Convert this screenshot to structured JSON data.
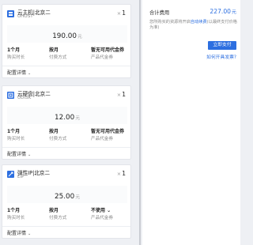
{
  "items": [
    {
      "title": "云主机|北京二",
      "subtitle": "UHOST",
      "icon": "server-icon",
      "qty_symbol": "×",
      "qty": "1",
      "price": "190.00",
      "price_unit": "元",
      "duration_value": "1个月",
      "duration_label": "购买时长",
      "pay_value": "按月",
      "pay_label": "付费方式",
      "coupon_value": "暂无可用代金券",
      "coupon_label": "产品代金券",
      "detail_label": "配置详情"
    },
    {
      "title": "云硬盘|北京二",
      "subtitle": "UDISK",
      "icon": "disk-icon",
      "qty_symbol": "×",
      "qty": "1",
      "price": "12.00",
      "price_unit": "元",
      "duration_value": "1个月",
      "duration_label": "购买时长",
      "pay_value": "按月",
      "pay_label": "付费方式",
      "coupon_value": "暂无可用代金券",
      "coupon_label": "产品代金券",
      "detail_label": "配置详情"
    },
    {
      "title": "弹性IP|北京二",
      "subtitle": "EIP",
      "icon": "eip-icon",
      "qty_symbol": "×",
      "qty": "1",
      "price": "25.00",
      "price_unit": "元",
      "duration_value": "1个月",
      "duration_label": "购买时长",
      "pay_value": "按月",
      "pay_label": "付费方式",
      "coupon_value": "不使用 ⌄",
      "coupon_label": "产品代金券",
      "detail_label": "配置详情"
    }
  ],
  "summary": {
    "total_label": "合计费用",
    "total_value": "227.00",
    "total_unit": "元",
    "note_prefix": "您所购买的资源将开启",
    "note_link": "自动续费",
    "note_suffix": "(以最终支付价格为准)",
    "pay_button": "立即支付",
    "invoice_link": "如何开具发票?"
  },
  "colors": {
    "accent": "#2d6fe0"
  }
}
